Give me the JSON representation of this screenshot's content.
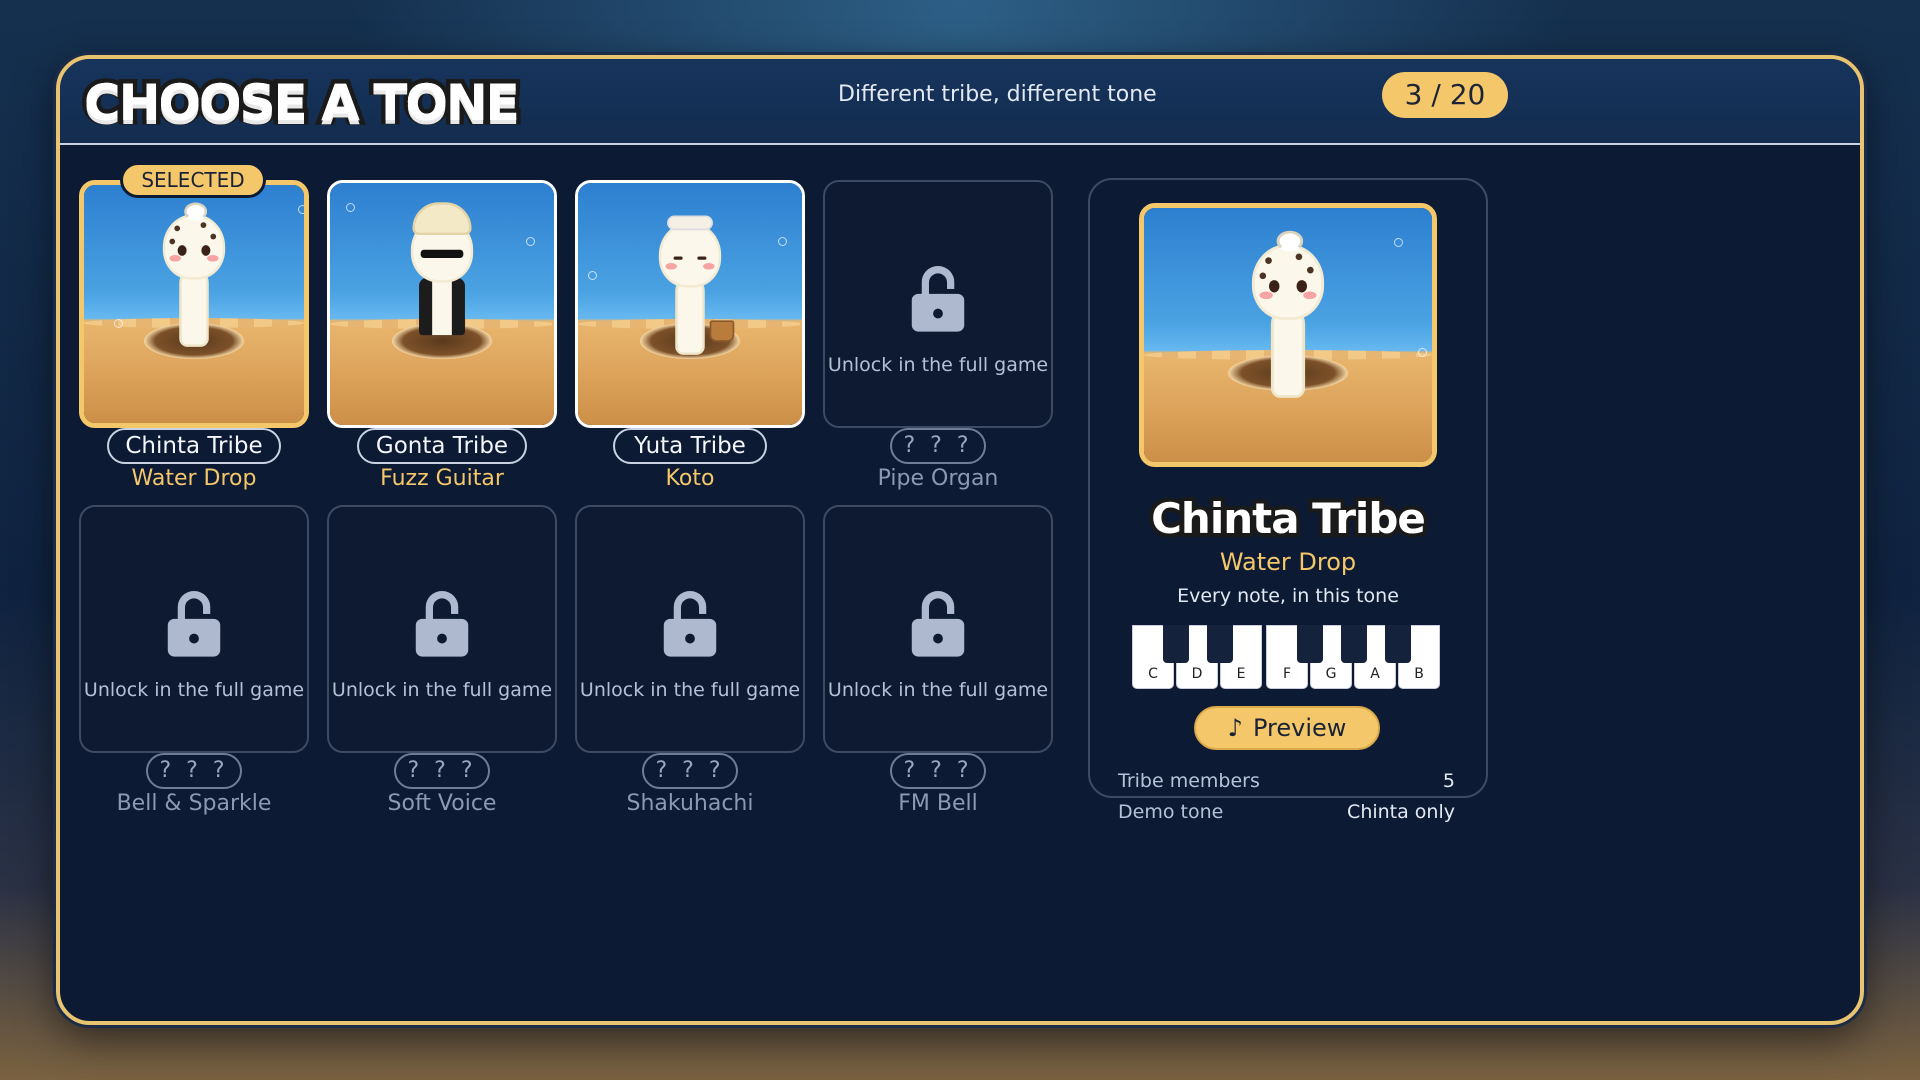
{
  "header": {
    "title": "CHOOSE A TONE",
    "subtitle": "Different tribe, different tone",
    "counter": "3 / 20"
  },
  "selected_badge": "SELECTED",
  "cards": [
    {
      "name": "Chinta Tribe",
      "tone": "Water Drop",
      "locked": false,
      "selected": true
    },
    {
      "name": "Gonta Tribe",
      "tone": "Fuzz Guitar",
      "locked": false,
      "selected": false
    },
    {
      "name": "Yuta Tribe",
      "tone": "Koto",
      "locked": false,
      "selected": false
    },
    {
      "name": "? ? ?",
      "tone": "Pipe Organ",
      "locked": true,
      "lock_text": "Unlock in the full game"
    },
    {
      "name": "? ? ?",
      "tone": "Bell & Sparkle",
      "locked": true,
      "lock_text": "Unlock in the full game"
    },
    {
      "name": "? ? ?",
      "tone": "Soft Voice",
      "locked": true,
      "lock_text": "Unlock in the full game"
    },
    {
      "name": "? ? ?",
      "tone": "Shakuhachi",
      "locked": true,
      "lock_text": "Unlock in the full game"
    },
    {
      "name": "? ? ?",
      "tone": "FM Bell",
      "locked": true,
      "lock_text": "Unlock in the full game"
    }
  ],
  "detail": {
    "name": "Chinta Tribe",
    "tone": "Water Drop",
    "caption": "Every note, in this tone",
    "keys": [
      "C",
      "D",
      "E",
      "F",
      "G",
      "A",
      "B"
    ],
    "preview_label": "Preview",
    "preview_icon": "music-note-icon",
    "stats": [
      {
        "label": "Tribe members",
        "value": "5"
      },
      {
        "label": "Demo tone",
        "value": "Chinta only"
      }
    ]
  },
  "colors": {
    "accent": "#f4c76a",
    "panel": "#0c1a33",
    "header": "#17345c",
    "locked_text": "#b4c0d6"
  }
}
